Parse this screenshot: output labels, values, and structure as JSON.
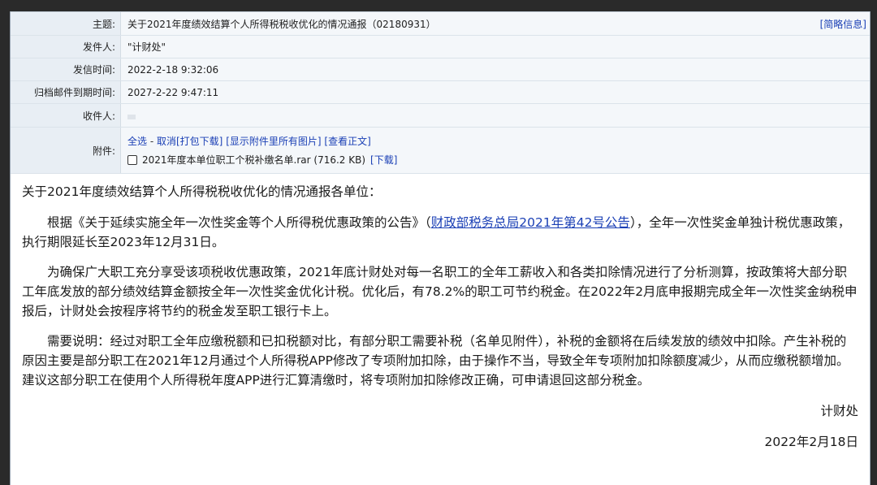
{
  "header": {
    "subject_label": "主题:",
    "subject_value": "关于2021年度绩效结算个人所得税税收优化的情况通报（02180931）",
    "brief_info": "[简略信息]",
    "sender_label": "发件人:",
    "sender_value": "\"计财处\"",
    "send_time_label": "发信时间:",
    "send_time_value": "2022-2-18 9:32:06",
    "archive_label": "归档邮件到期时间:",
    "archive_value": "2027-2-22 9:47:11",
    "recipient_label": "收件人:",
    "attach_label": "附件:"
  },
  "attachments": {
    "select_all": "全选",
    "cancel": "取消",
    "pack_download": "[打包下载]",
    "show_images": "[显示附件里所有图片]",
    "view_text": "[查看正文]",
    "file_name": "2021年度本单位职工个税补缴名单.rar (716.2 KB)",
    "download": "[下载]"
  },
  "body": {
    "greeting": "关于2021年度绩效结算个人所得税税收优化的情况通报各单位：",
    "p1_pre": "根据《关于延续实施全年一次性奖金等个人所得税优惠政策的公告》（",
    "p1_link": "财政部税务总局2021年第42号公告",
    "p1_post": "），全年一次性奖金单独计税优惠政策，执行期限延长至2023年12月31日。",
    "p2": "为确保广大职工充分享受该项税收优惠政策，2021年底计财处对每一名职工的全年工薪收入和各类扣除情况进行了分析测算，按政策将大部分职工年底发放的部分绩效结算金额按全年一次性奖金优化计税。优化后，有78.2%的职工可节约税金。在2022年2月底申报期完成全年一次性奖金纳税申报后，计财处会按程序将节约的税金发至职工银行卡上。",
    "p3": "需要说明：经过对职工全年应缴税额和已扣税额对比，有部分职工需要补税（名单见附件），补税的金额将在后续发放的绩效中扣除。产生补税的原因主要是部分职工在2021年12月通过个人所得税APP修改了专项附加扣除，由于操作不当，导致全年专项附加扣除额度减少，从而应缴税额增加。建议这部分职工在使用个人所得税年度APP进行汇算清缴时，将专项附加扣除修改正确，可申请退回这部分税金。",
    "signature": "计财处",
    "date": "2022年2月18日"
  }
}
